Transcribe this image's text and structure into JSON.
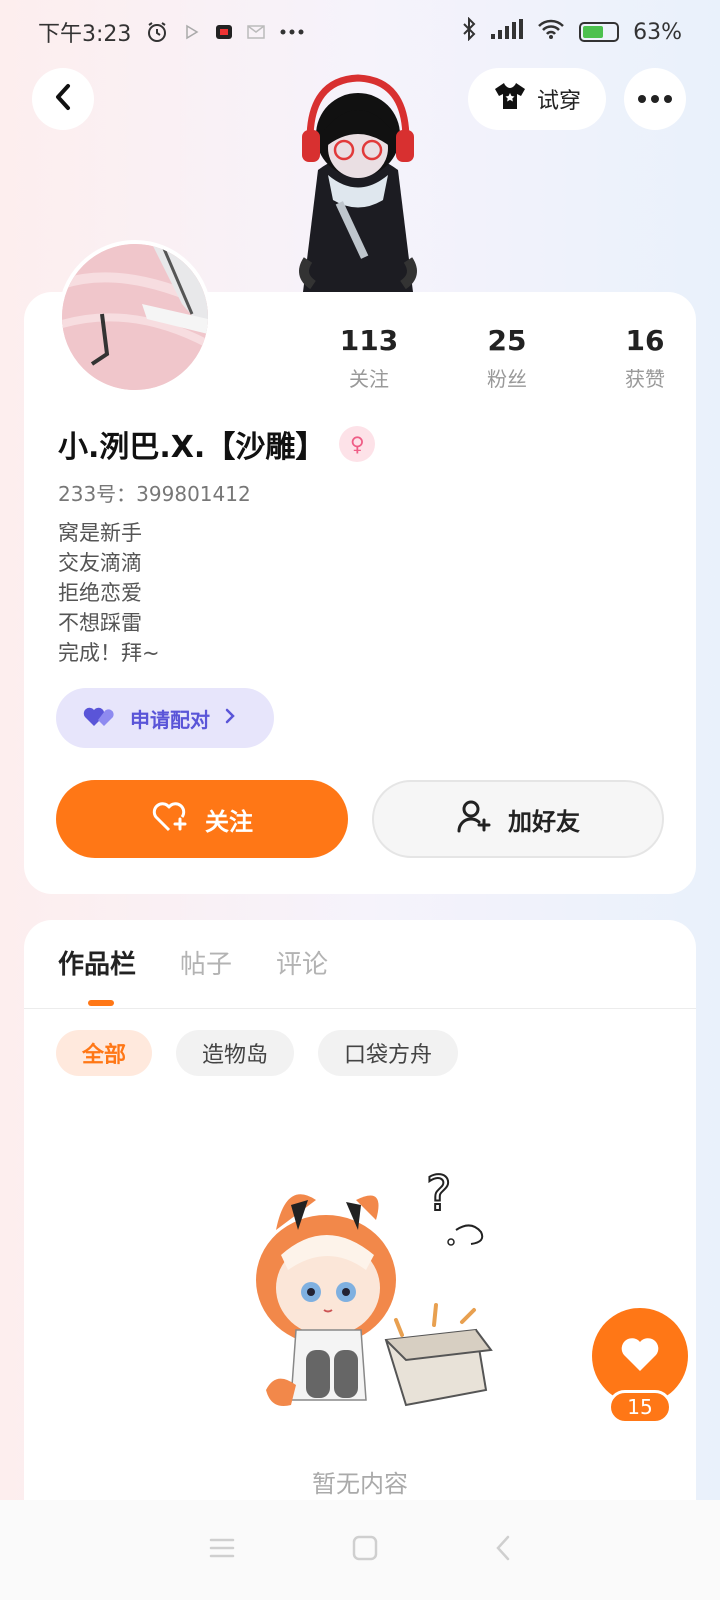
{
  "status_bar": {
    "time": "下午3:23",
    "battery_percent": "63%",
    "battery_level": 0.63,
    "icons": [
      "alarm-icon",
      "play-icon",
      "app-notification-icon",
      "mail-icon",
      "more-icon",
      "bluetooth-icon",
      "signal-icon",
      "wifi-icon",
      "battery-icon"
    ]
  },
  "header": {
    "try_on_label": "试穿"
  },
  "stats": [
    {
      "value": "113",
      "label": "关注"
    },
    {
      "value": "25",
      "label": "粉丝"
    },
    {
      "value": "16",
      "label": "获赞"
    }
  ],
  "profile": {
    "username": "小.洌巴.X.【沙雕】",
    "gender": "female",
    "uid": "233号：399801412",
    "bio": [
      "窝是新手",
      "交友滴滴",
      "拒绝恋爱",
      "不想踩雷",
      "完成！拜~"
    ]
  },
  "pair_button": {
    "label": "申请配对"
  },
  "actions": {
    "follow_label": "关注",
    "add_friend_label": "加好友"
  },
  "tabs": [
    {
      "label": "作品栏",
      "active": true
    },
    {
      "label": "帖子",
      "active": false
    },
    {
      "label": "评论",
      "active": false
    }
  ],
  "filter_chips": [
    {
      "label": "全部",
      "active": true
    },
    {
      "label": "造物岛",
      "active": false
    },
    {
      "label": "口袋方舟",
      "active": false
    }
  ],
  "empty_state": {
    "text": "暂无内容"
  },
  "like_fab": {
    "count": "15"
  },
  "colors": {
    "accent": "#ff7716",
    "pair_bg": "#e7e5fb",
    "pair_text": "#5a55d8",
    "gender": "#ef5d86"
  }
}
